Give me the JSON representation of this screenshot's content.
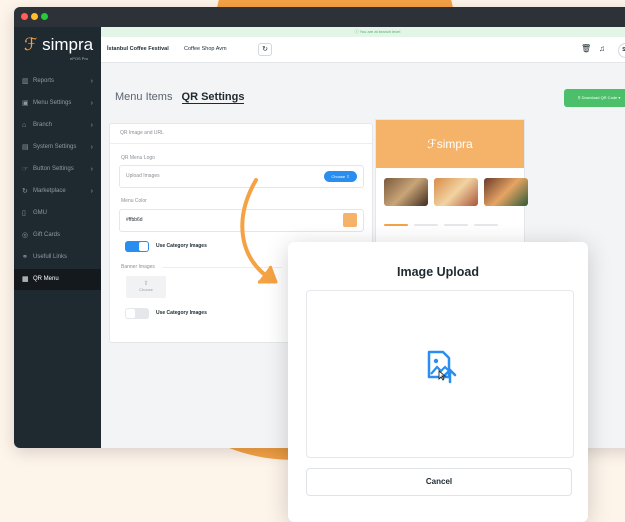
{
  "app": {
    "logo": "simpra",
    "logo_sub": "ePOS Pro"
  },
  "banner": {
    "text": "You are at branch level"
  },
  "topbar": {
    "company": "İstanbul Coffee Festival",
    "branch": "Coffee Shop Avm",
    "user_initials": "SF"
  },
  "sidebar": {
    "items": [
      {
        "label": "Reports",
        "icon": "bar-chart-icon"
      },
      {
        "label": "Menu Settings",
        "icon": "menu-settings-icon"
      },
      {
        "label": "Branch",
        "icon": "branch-icon"
      },
      {
        "label": "System Settings",
        "icon": "system-settings-icon"
      },
      {
        "label": "Button Settings",
        "icon": "button-settings-icon"
      },
      {
        "label": "Marketplace",
        "icon": "marketplace-icon"
      },
      {
        "label": "GMU",
        "icon": "gmu-icon"
      },
      {
        "label": "Gift Cards",
        "icon": "gift-card-icon"
      },
      {
        "label": "Usefull Links",
        "icon": "link-icon"
      },
      {
        "label": "QR Menu",
        "icon": "qr-icon"
      }
    ]
  },
  "tabs": {
    "menu_items": "Menu Items",
    "qr_settings": "QR Settings"
  },
  "download_btn": "Download QR Code",
  "card": {
    "header": "QR Image and URL",
    "logo_label": "QR Menu Logo",
    "upload_placeholder": "Upload Images",
    "choose_label": "Choose",
    "color_label": "Menu Color",
    "color_value": "#ffbb6d",
    "use_category_1": "Use Category Images",
    "banner_label": "Banner Images",
    "choose_small": "Choose",
    "use_category_2": "Use Category Images"
  },
  "preview": {
    "logo": "simpra"
  },
  "modal": {
    "title": "Image Upload",
    "cancel": "Cancel"
  },
  "colors": {
    "accent": "#f5a245",
    "sidebar": "#1f2a30",
    "primary": "#2a8df0",
    "success": "#4cbf6a",
    "swatch": "#f5b36a"
  }
}
